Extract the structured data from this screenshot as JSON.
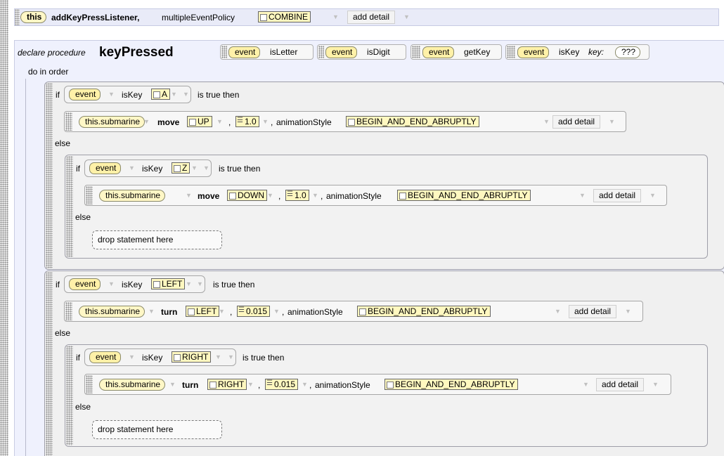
{
  "listener": {
    "target": "this",
    "method": "addKeyPressListener,",
    "policy_label": "multipleEventPolicy",
    "policy_value": "COMBINE",
    "add_detail": "add detail"
  },
  "procedure": {
    "declare_label": "declare procedure",
    "name": "keyPressed",
    "params": [
      {
        "object": "event",
        "method": "isLetter"
      },
      {
        "object": "event",
        "method": "isDigit"
      },
      {
        "object": "event",
        "method": "getKey"
      },
      {
        "object": "event",
        "method": "isKey",
        "arg_label": "key:",
        "arg_value": "???"
      }
    ]
  },
  "body": {
    "do_in_order": "do in order",
    "keywords": {
      "if": "if",
      "is_true_then": "is true then",
      "else": "else",
      "comma": ",",
      "is_key": "isKey",
      "animation_style": "animationStyle"
    },
    "drop_statement": "drop statement here",
    "blocks": [
      {
        "key": "A",
        "then": {
          "target": "this.submarine",
          "method": "move",
          "direction": "UP",
          "amount": "1.0",
          "style": "BEGIN_AND_END_ABRUPTLY",
          "add_detail": "add detail"
        },
        "else_if": {
          "key": "Z",
          "then": {
            "target": "this.submarine",
            "method": "move",
            "direction": "DOWN",
            "amount": "1.0",
            "style": "BEGIN_AND_END_ABRUPTLY",
            "add_detail": "add detail"
          }
        }
      },
      {
        "key": "LEFT",
        "then": {
          "target": "this.submarine",
          "method": "turn",
          "direction": "LEFT",
          "amount": "0.015",
          "style": "BEGIN_AND_END_ABRUPTLY",
          "add_detail": "add detail"
        },
        "else_if": {
          "key": "RIGHT",
          "then": {
            "target": "this.submarine",
            "method": "turn",
            "direction": "RIGHT",
            "amount": "0.015",
            "style": "BEGIN_AND_END_ABRUPTLY",
            "add_detail": "add detail"
          }
        }
      }
    ]
  },
  "colors": {
    "page_bg": "#ffffff",
    "procedure_bg": "#eff1fd",
    "listener_bg": "#e9ebf8",
    "pill_fill": "#fff7c6",
    "block_fill": "#f0f0f0"
  }
}
